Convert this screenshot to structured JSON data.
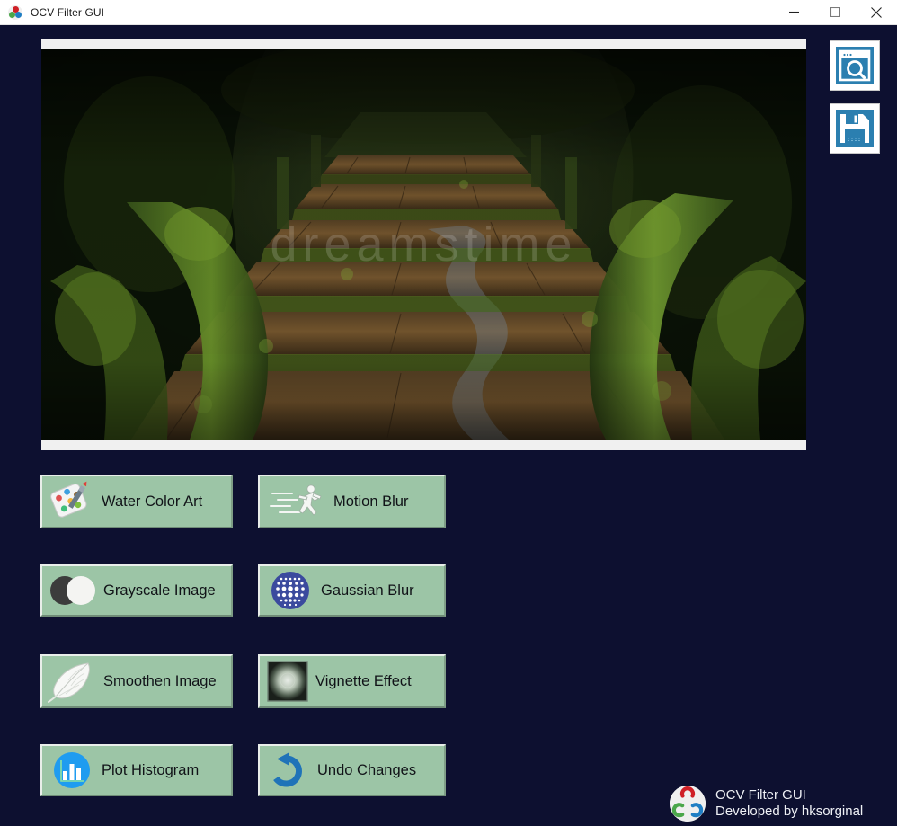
{
  "window": {
    "title": "OCV Filter GUI",
    "icon": "opencv-logo-icon",
    "controls": {
      "minimize": "Minimize",
      "maximize": "Maximize",
      "close": "Close"
    },
    "background_color": "#0d1030",
    "titlebar_color": "#ffffff"
  },
  "toolbar": {
    "open_label": "Open Image",
    "open_icon": "browse-image-icon",
    "save_label": "Save Image",
    "save_icon": "floppy-disk-save-icon",
    "button_color": "#2b7fb0"
  },
  "canvas": {
    "name": "image-preview",
    "watermark": "dreamstime",
    "alt": "Mossy wooden boardwalk steps in a green forest",
    "scrollbar_color": "#f0f0f0"
  },
  "filters": {
    "accent_color": "#9cc5a6",
    "items": [
      {
        "label": "Water Color Art",
        "icon": "paint-palette-icon",
        "name": "filter-water-color-art"
      },
      {
        "label": "Motion Blur",
        "icon": "running-person-icon",
        "name": "filter-motion-blur"
      },
      {
        "label": "Grayscale Image",
        "icon": "two-circles-icon",
        "name": "filter-grayscale-image"
      },
      {
        "label": "Gaussian Blur",
        "icon": "dot-grid-circle-icon",
        "name": "filter-gaussian-blur"
      },
      {
        "label": "Smoothen Image",
        "icon": "feather-icon",
        "name": "filter-smoothen-image"
      },
      {
        "label": "Vignette Effect",
        "icon": "vignette-square-icon",
        "name": "filter-vignette-effect"
      },
      {
        "label": "Plot Histogram",
        "icon": "bar-chart-icon",
        "name": "filter-plot-histogram"
      },
      {
        "label": "Undo Changes",
        "icon": "undo-arrow-icon",
        "name": "filter-undo-changes"
      }
    ]
  },
  "footer": {
    "logo": "opencv-logo-icon",
    "app_name": "OCV Filter GUI",
    "developer": "Developed by hksorginal"
  }
}
